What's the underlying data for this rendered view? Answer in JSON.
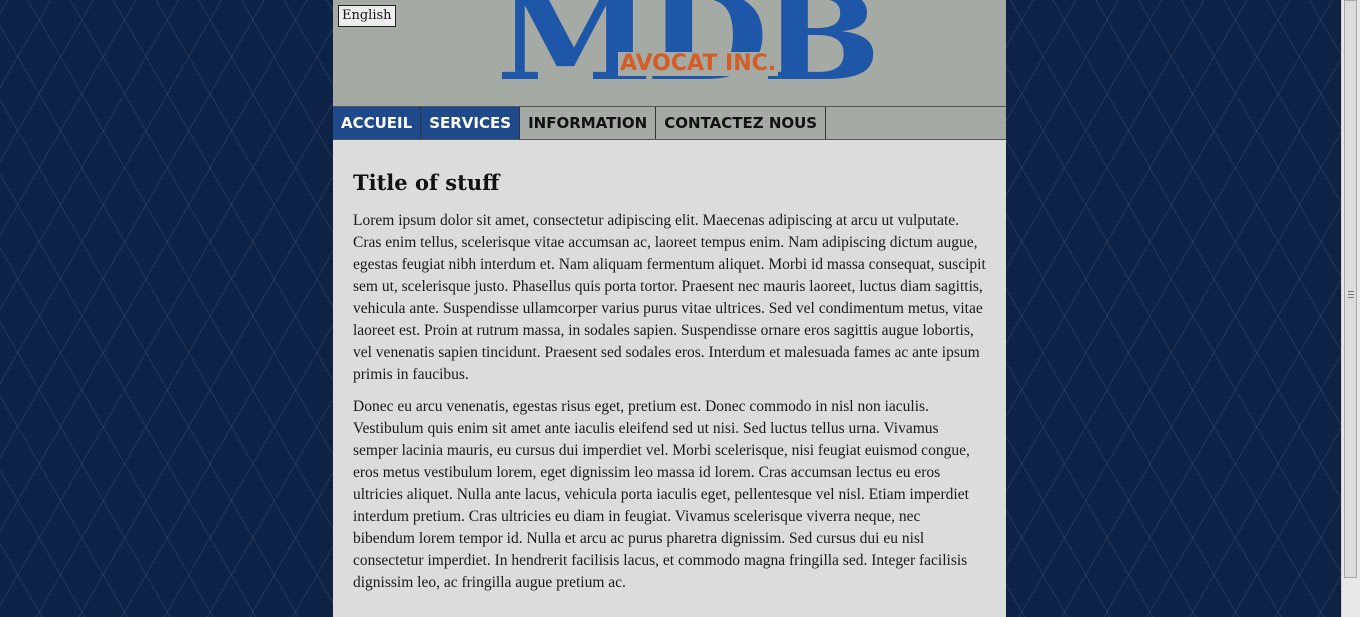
{
  "header": {
    "language_button": "English",
    "logo_main": "MDB",
    "logo_sub": "AVOCAT INC."
  },
  "nav": [
    {
      "label": "ACCUEIL",
      "active": true
    },
    {
      "label": "SERVICES",
      "active": true
    },
    {
      "label": "INFORMATION",
      "active": false
    },
    {
      "label": "CONTACTEZ NOUS",
      "active": false
    }
  ],
  "main": {
    "title": "Title of stuff",
    "paragraphs": [
      "Lorem ipsum dolor sit amet, consectetur adipiscing elit. Maecenas adipiscing at arcu ut vulputate. Cras enim tellus, scelerisque vitae accumsan ac, laoreet tempus enim. Nam adipiscing dictum augue, egestas feugiat nibh interdum et. Nam aliquam fermentum aliquet. Morbi id massa consequat, suscipit sem ut, scelerisque justo. Phasellus quis porta tortor. Praesent nec mauris laoreet, luctus diam sagittis, vehicula ante. Suspendisse ullamcorper varius purus vitae ultrices. Sed vel condimentum metus, vitae laoreet est. Proin at rutrum massa, in sodales sapien. Suspendisse ornare eros sagittis augue lobortis, vel venenatis sapien tincidunt. Praesent sed sodales eros. Interdum et malesuada fames ac ante ipsum primis in faucibus.",
      "Donec eu arcu venenatis, egestas risus eget, pretium est. Donec commodo in nisl non iaculis. Vestibulum quis enim sit amet ante iaculis eleifend sed ut nisi. Sed luctus tellus urna. Vivamus semper lacinia mauris, eu cursus dui imperdiet vel. Morbi scelerisque, nisi feugiat euismod congue, eros metus vestibulum lorem, eget dignissim leo massa id lorem. Cras accumsan lectus eu eros ultricies aliquet. Nulla ante lacus, vehicula porta iaculis eget, pellentesque vel nisl. Etiam imperdiet interdum pretium. Cras ultricies eu diam in feugiat. Vivamus scelerisque viverra neque, nec bibendum lorem tempor id. Nulla et arcu ac purus pharetra dignissim. Sed cursus dui eu nisl consectetur imperdiet. In hendrerit facilisis lacus, et commodo magna fringilla sed. Integer facilisis dignissim leo, ac fringilla augue pretium ac."
    ]
  },
  "colors": {
    "background": "#0e2246",
    "brand_blue": "#1f57a8",
    "brand_orange": "#d65c26",
    "nav_active": "#1e4a8c",
    "header_gray": "#a5aaa4",
    "content_bg": "#dcdcdc"
  }
}
